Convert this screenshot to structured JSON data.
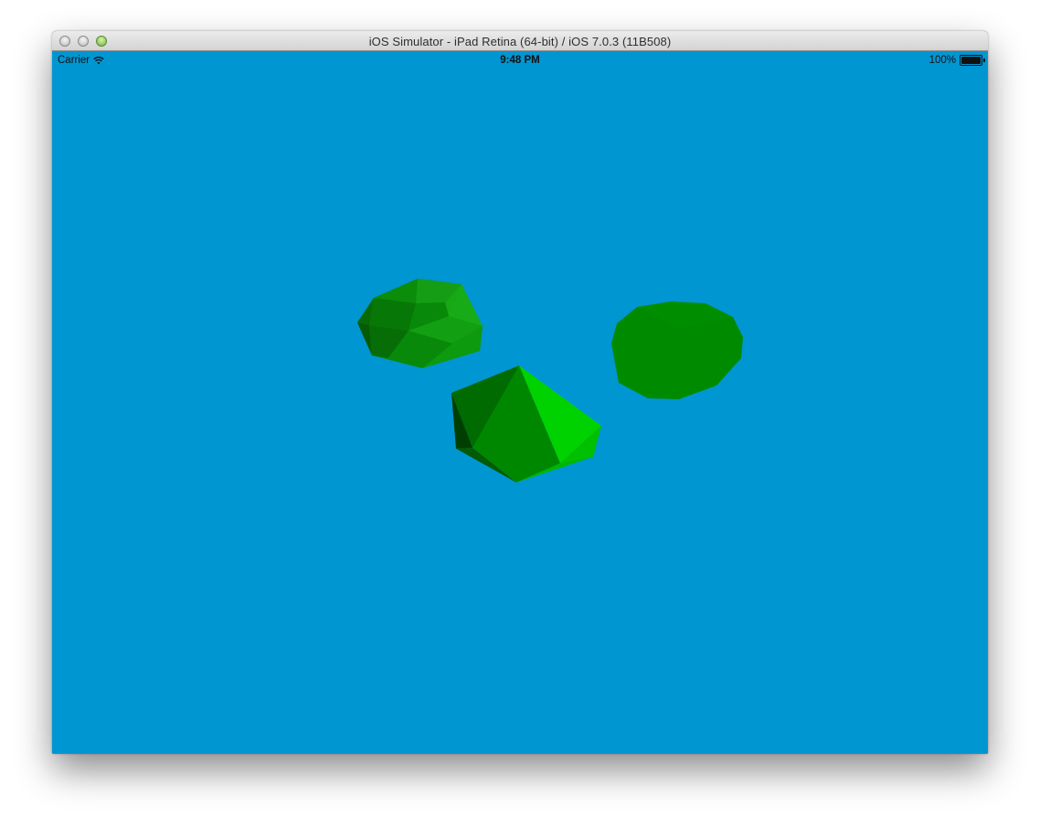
{
  "window": {
    "title": "iOS Simulator - iPad Retina (64-bit) / iOS 7.0.3 (11B508)"
  },
  "status_bar": {
    "carrier": "Carrier",
    "wifi_icon": "wifi-icon",
    "time": "9:48 PM",
    "battery_percent": "100%",
    "battery_level": 1.0
  },
  "scene": {
    "background_color": "#0096d2",
    "objects": [
      {
        "name": "faceted-green-sphere",
        "color": "#0a8c0a"
      },
      {
        "name": "green-octahedron",
        "color": "#00cc00"
      },
      {
        "name": "flat-green-ellipse",
        "color": "#008a00"
      }
    ]
  }
}
